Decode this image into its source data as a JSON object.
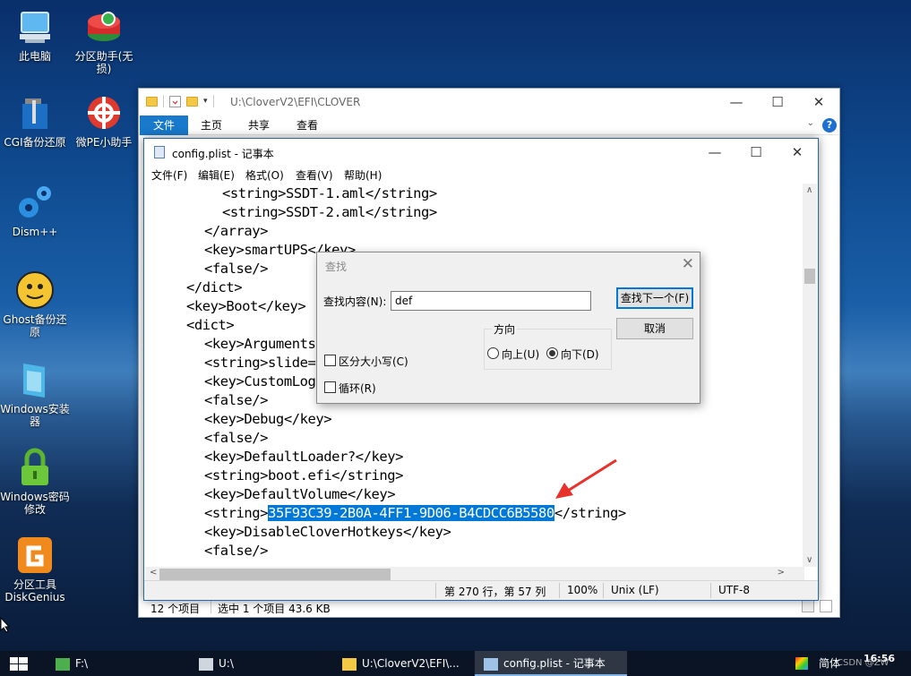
{
  "desktop": {
    "icons": [
      {
        "label": "此电脑",
        "icon": "computer-icon"
      },
      {
        "label": "分区助手(无损)",
        "icon": "partition-assistant-icon"
      },
      {
        "label": "CGI备份还原",
        "icon": "cgi-backup-icon"
      },
      {
        "label": "微PE小助手",
        "icon": "wepe-helper-icon"
      },
      {
        "label": "Dism++",
        "icon": "dism-gear-icon"
      },
      {
        "label": "Ghost备份还原",
        "icon": "ghost-icon"
      },
      {
        "label": "Windows安装器",
        "icon": "windows-installer-icon"
      },
      {
        "label": "Windows密码修改",
        "icon": "lock-icon"
      },
      {
        "label": "分区工具DiskGenius",
        "icon": "diskgenius-icon"
      }
    ]
  },
  "explorer": {
    "path": "U:\\CloverV2\\EFI\\CLOVER",
    "tabs": [
      "文件",
      "主页",
      "共享",
      "查看"
    ],
    "status_items": "12 个项目",
    "status_selected": "选中 1 个项目  43.6 KB"
  },
  "notepad": {
    "title": "config.plist - 记事本",
    "menu": [
      "文件(F)",
      "编辑(E)",
      "格式(O)",
      "查看(V)",
      "帮助(H)"
    ],
    "lines": [
      {
        "indent": 2,
        "text": "<string>SSDT-1.aml</string>"
      },
      {
        "indent": 2,
        "text": "<string>SSDT-2.aml</string>"
      },
      {
        "indent": 1,
        "text": "</array>"
      },
      {
        "indent": 1,
        "text": "<key>smartUPS</key>"
      },
      {
        "indent": 1,
        "text": "<false/>"
      },
      {
        "indent": 0,
        "text": "</dict>"
      },
      {
        "indent": 0,
        "text": "<key>Boot</key>"
      },
      {
        "indent": 0,
        "text": "<dict>"
      },
      {
        "indent": 1,
        "text": "<key>Arguments</key>"
      },
      {
        "indent": 1,
        "text": "<string>slide=0 </string>"
      },
      {
        "indent": 1,
        "text": "<key>CustomLogo</key>"
      },
      {
        "indent": 1,
        "text": "<false/>"
      },
      {
        "indent": 1,
        "text": "<key>Debug</key>"
      },
      {
        "indent": 1,
        "text": "<false/>"
      },
      {
        "indent": 1,
        "text": "<key>DefaultLoader?</key>"
      },
      {
        "indent": 1,
        "text": "<string>boot.efi</string>"
      },
      {
        "indent": 1,
        "text": "<key>DefaultVolume</key>"
      },
      {
        "indent": 1,
        "text": "<string>",
        "selected": "35F93C39-2B0A-4FF1-9D06-B4CDCC6B5580",
        "after": "</string>"
      },
      {
        "indent": 1,
        "text": "<key>DisableCloverHotkeys</key>"
      },
      {
        "indent": 1,
        "text": "<false/>"
      }
    ],
    "status": {
      "position": "第 270 行，第 57 列",
      "zoom": "100%",
      "eol": "Unix (LF)",
      "encoding": "UTF-8"
    }
  },
  "find_dialog": {
    "title": "查找",
    "find_label": "查找内容(N):",
    "find_value": "def",
    "find_next": "查找下一个(F)",
    "cancel": "取消",
    "direction_label": "方向",
    "up_label": "向上(U)",
    "down_label": "向下(D)",
    "match_case": "区分大小写(C)",
    "wrap": "循环(R)",
    "direction_selected": "down"
  },
  "taskbar": {
    "items": [
      "F:\\",
      "U:\\",
      "U:\\CloverV2\\EFI\\...",
      "config.plist - 记事本"
    ],
    "ime": "简体",
    "clock": "16:56",
    "watermark": "CSDN @ZW"
  },
  "colors": {
    "accent": "#0078d7",
    "ribbon_tab": "#1979ca",
    "arrow": "#e8312a"
  }
}
